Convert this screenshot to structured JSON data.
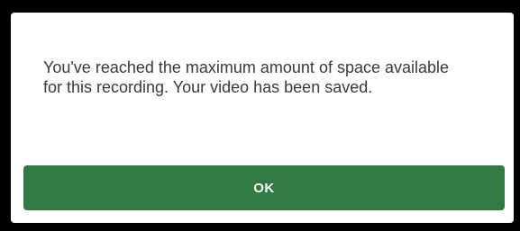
{
  "dialog": {
    "message": "You've reached the maximum amount of space available for this recording. Your video has been saved.",
    "ok_label": "OK"
  },
  "colors": {
    "backdrop": "#000000",
    "dialog_background": "#ffffff",
    "button_background": "#327a43",
    "button_text": "#ffffff",
    "message_text": "#3a3a3a"
  }
}
